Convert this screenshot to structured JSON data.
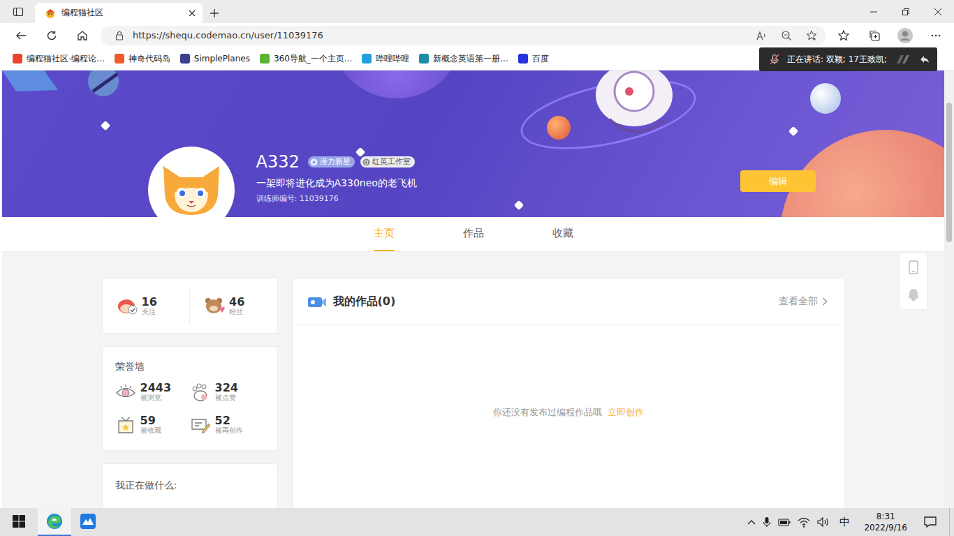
{
  "browser": {
    "tabs": [
      {
        "title": "编程猫社区",
        "selected": true
      }
    ],
    "url": "https://shequ.codemao.cn/user/11039176",
    "bookmarks": [
      {
        "label": "编程猫社区-编程论...",
        "color": "#e8452c"
      },
      {
        "label": "神奇代码岛",
        "color": "#f05a28"
      },
      {
        "label": "SimplePlanes",
        "color": "#3b3f8f"
      },
      {
        "label": "360导航_一个主页...",
        "color": "#5cb531"
      },
      {
        "label": "哔哩哔哩",
        "color": "#20a0e0"
      },
      {
        "label": "新概念英语第一册...",
        "color": "#1a8fa8"
      },
      {
        "label": "百度",
        "color": "#2932e1"
      }
    ]
  },
  "voice_overlay": {
    "text": "正在讲话: 双颖; 17王致凯;",
    "muted": true
  },
  "profile": {
    "name": "A332",
    "badges": [
      {
        "label": "潜力新星",
        "kind": "level"
      },
      {
        "label": "红英工作室",
        "kind": "studio"
      }
    ],
    "bio": "一架即将进化成为A330neo的老飞机",
    "trainer_id": "训练师编号: 11039176",
    "edit_button": "编辑"
  },
  "nav_tabs": [
    {
      "label": "主页",
      "selected": true
    },
    {
      "label": "作品",
      "selected": false
    },
    {
      "label": "收藏",
      "selected": false
    }
  ],
  "follow_stats": [
    {
      "value": "16",
      "label": "关注",
      "kind": "follow"
    },
    {
      "value": "46",
      "label": "粉丝",
      "kind": "fans"
    }
  ],
  "honor_wall": {
    "title": "荣誉墙",
    "stats": [
      {
        "value": "2443",
        "label": "被浏览",
        "kind": "view"
      },
      {
        "value": "324",
        "label": "被点赞",
        "kind": "like"
      },
      {
        "value": "59",
        "label": "被收藏",
        "kind": "collect"
      },
      {
        "value": "52",
        "label": "被再创作",
        "kind": "remix"
      }
    ]
  },
  "status_card": {
    "title": "我正在做什么:"
  },
  "works": {
    "title": "我的作品(0)",
    "view_all": "查看全部",
    "empty_text": "你还没有发布过编程作品哦",
    "create_link": "立即创作"
  },
  "taskbar": {
    "apps": [
      {
        "kind": "edge",
        "selected": true
      },
      {
        "kind": "app",
        "selected": false
      }
    ],
    "ime": "中",
    "time": "8:31",
    "date": "2022/9/16"
  }
}
